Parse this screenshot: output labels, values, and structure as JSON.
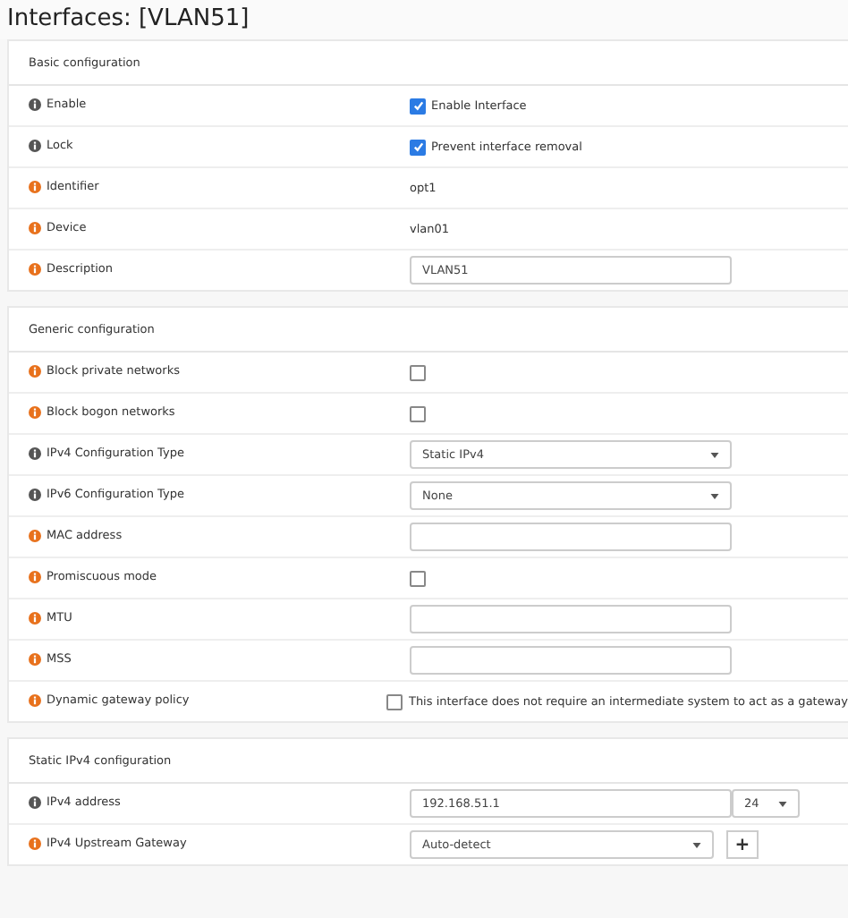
{
  "page_title": "Interfaces: [VLAN51]",
  "sections": [
    {
      "title": "Basic configuration",
      "rows": [
        {
          "label": "Enable",
          "color": "#555555",
          "kind": "checkbox",
          "checked": true,
          "text": "Enable Interface"
        },
        {
          "label": "Lock",
          "color": "#555555",
          "kind": "checkbox",
          "checked": true,
          "text": "Prevent interface removal"
        },
        {
          "label": "Identifier",
          "color": "#e8711c",
          "kind": "text",
          "text": "opt1"
        },
        {
          "label": "Device",
          "color": "#e8711c",
          "kind": "text",
          "text": "vlan01"
        },
        {
          "label": "Description",
          "color": "#e8711c",
          "kind": "input",
          "value": "VLAN51"
        }
      ]
    },
    {
      "title": "Generic configuration",
      "rows": [
        {
          "label": "Block private networks",
          "color": "#e8711c",
          "kind": "checkbox",
          "checked": false
        },
        {
          "label": "Block bogon networks",
          "color": "#e8711c",
          "kind": "checkbox",
          "checked": false
        },
        {
          "label": "IPv4 Configuration Type",
          "color": "#555555",
          "kind": "select",
          "value": "Static IPv4"
        },
        {
          "label": "IPv6 Configuration Type",
          "color": "#555555",
          "kind": "select",
          "value": "None"
        },
        {
          "label": "MAC address",
          "color": "#e8711c",
          "kind": "input"
        },
        {
          "label": "Promiscuous mode",
          "color": "#e8711c",
          "kind": "checkbox",
          "checked": false
        },
        {
          "label": "MTU",
          "color": "#e8711c",
          "kind": "input"
        },
        {
          "label": "MSS",
          "color": "#e8711c",
          "kind": "input"
        },
        {
          "label": "Dynamic gateway policy",
          "color": "#e8711c",
          "kind": "checkbox",
          "checked": false,
          "text": "This interface does not require an intermediate system to act as a gateway"
        }
      ]
    },
    {
      "title": "Static IPv4 configuration",
      "rows": [
        {
          "label": "IPv4 address",
          "color": "#555555",
          "kind": "cidr",
          "value": "192.168.51.1",
          "mask": "24"
        },
        {
          "label": "IPv4 Upstream Gateway",
          "color": "#e8711c",
          "kind": "select_add",
          "value": "Auto-detect",
          "button": "+"
        }
      ]
    }
  ]
}
